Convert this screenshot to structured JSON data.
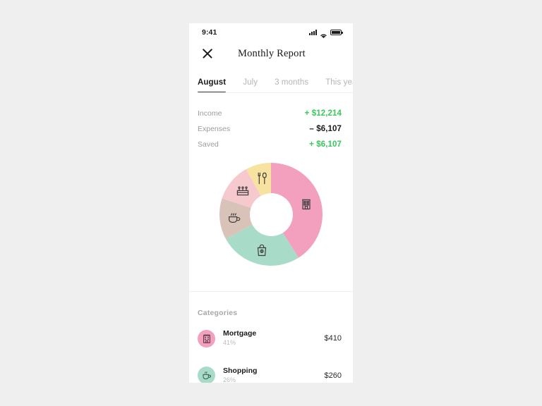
{
  "status_bar": {
    "time": "9:41",
    "signal_icon": "signal-bars-icon",
    "wifi_icon": "wifi-icon",
    "battery_icon": "battery-full-icon"
  },
  "nav": {
    "close_icon": "close-icon",
    "title": "Monthly Report"
  },
  "tabs": [
    {
      "label": "August",
      "active": true
    },
    {
      "label": "July",
      "active": false
    },
    {
      "label": "3 months",
      "active": false
    },
    {
      "label": "This year",
      "active": false
    }
  ],
  "summary": [
    {
      "label": "Income",
      "value": "+ $12,214",
      "tone": "green"
    },
    {
      "label": "Expenses",
      "value": "– $6,107",
      "tone": "dark"
    },
    {
      "label": "Saved",
      "value": "+ $6,107",
      "tone": "green"
    }
  ],
  "categories_header": "Categories",
  "categories": [
    {
      "name": "Mortgage",
      "pct": "41%",
      "amount": "$410",
      "color": "#F2A0BE",
      "icon": "building-icon"
    },
    {
      "name": "Shopping",
      "pct": "26%",
      "amount": "$260",
      "color": "#A8DCC8",
      "icon": "coffee-cup-icon"
    }
  ],
  "colors": {
    "green": "#38C85A",
    "dark": "#1A1A1A",
    "muted": "#9C9C9C",
    "page_bg": "#F0EFEF",
    "card_bg": "#FFFFFF"
  },
  "chart_data": {
    "type": "pie",
    "title": "",
    "variant": "donut",
    "legend": "none",
    "inner_radius_ratio": 0.42,
    "categories": [
      "Mortgage",
      "Shopping",
      "Coffee",
      "Celebrations",
      "Restaurants"
    ],
    "values": [
      41,
      26,
      13,
      12,
      8
    ],
    "unit": "%",
    "colors": [
      "#F2A0BE",
      "#A8DCC8",
      "#D9C3B8",
      "#F5C9CE",
      "#F8E2A0"
    ],
    "icons": [
      "building-icon",
      "shopping-bag-icon",
      "coffee-cup-icon",
      "cake-icon",
      "fork-knife-icon"
    ],
    "start_angle_deg": 0,
    "direction": "clockwise"
  }
}
